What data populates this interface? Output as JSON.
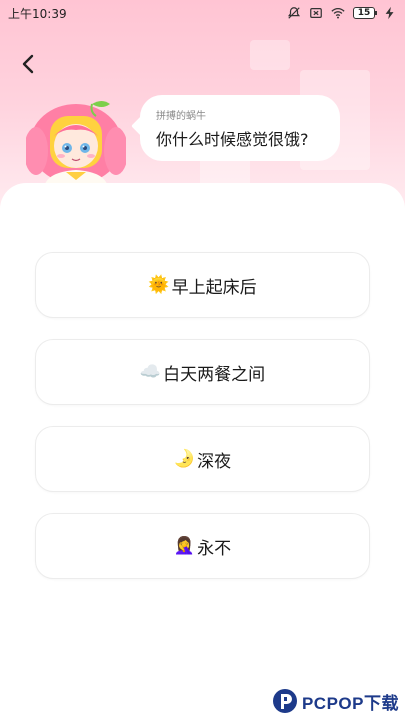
{
  "status_bar": {
    "time": "上午10:39",
    "battery": "15"
  },
  "prompt": {
    "author": "拼搏的蜗牛",
    "question": "你什么时候感觉很饿?"
  },
  "options": [
    {
      "emoji": "🌞",
      "label": "早上起床后"
    },
    {
      "emoji": "☁️",
      "label": "白天两餐之间"
    },
    {
      "emoji": "🌛",
      "label": "深夜"
    },
    {
      "emoji": "🤦‍♀️",
      "label": "永不"
    }
  ],
  "watermark": {
    "text": "PCPOP下载"
  },
  "icons": {
    "back": "chevron-left-icon",
    "mute": "bell-off-icon",
    "sim": "no-sim-icon",
    "wifi": "wifi-icon",
    "battery": "battery-icon",
    "charging": "lightning-icon"
  },
  "colors": {
    "hero_top": "#ffc4d3",
    "hero_bottom": "#fff0f3",
    "watermark": "#1d3a8a"
  }
}
